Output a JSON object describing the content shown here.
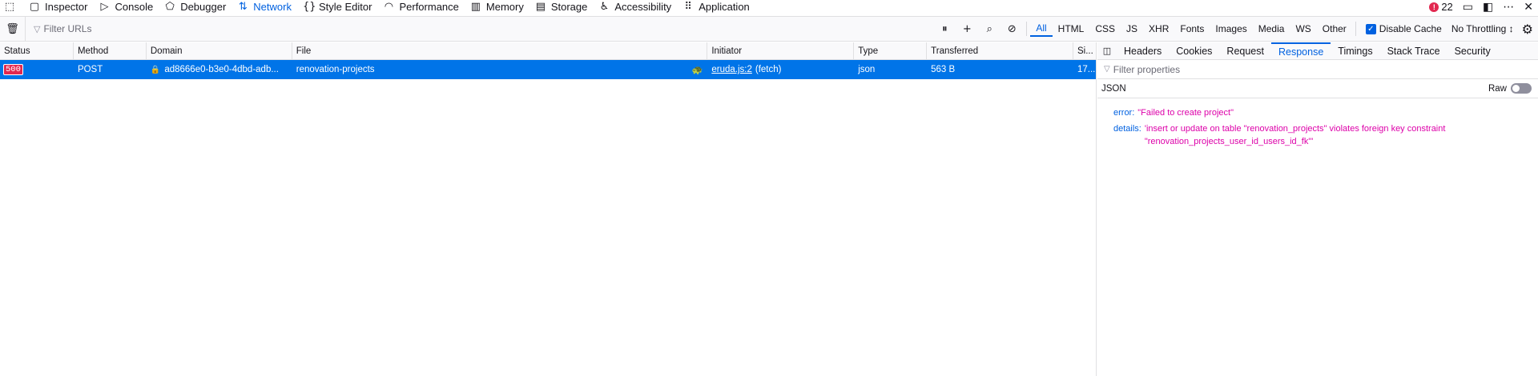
{
  "toolbar": {
    "tabs": [
      {
        "label": "Inspector",
        "icon": "inspector-icon"
      },
      {
        "label": "Console",
        "icon": "console-icon"
      },
      {
        "label": "Debugger",
        "icon": "debugger-icon"
      },
      {
        "label": "Network",
        "icon": "network-icon"
      },
      {
        "label": "Style Editor",
        "icon": "style-editor-icon"
      },
      {
        "label": "Performance",
        "icon": "performance-icon"
      },
      {
        "label": "Memory",
        "icon": "memory-icon"
      },
      {
        "label": "Storage",
        "icon": "storage-icon"
      },
      {
        "label": "Accessibility",
        "icon": "accessibility-icon"
      },
      {
        "label": "Application",
        "icon": "application-icon"
      }
    ],
    "active_tab": "Network",
    "error_count": "22"
  },
  "filterbar": {
    "placeholder": "Filter URLs",
    "types": [
      "All",
      "HTML",
      "CSS",
      "JS",
      "XHR",
      "Fonts",
      "Images",
      "Media",
      "WS",
      "Other"
    ],
    "active_type": "All",
    "disable_cache_label": "Disable Cache",
    "throttling": "No Throttling ↕"
  },
  "table": {
    "columns": [
      "Status",
      "Method",
      "Domain",
      "File",
      "Initiator",
      "Type",
      "Transferred",
      "Si..."
    ],
    "rows": [
      {
        "status": "500",
        "method": "POST",
        "domain": "ad8666e0-b3e0-4dbd-adb...",
        "file": "renovation-projects",
        "initiator_link": "eruda.js:2",
        "initiator_extra": "(fetch)",
        "type": "json",
        "transferred": "563 B",
        "size": "17..."
      }
    ]
  },
  "details": {
    "tabs": [
      "Headers",
      "Cookies",
      "Request",
      "Response",
      "Timings",
      "Stack Trace",
      "Security"
    ],
    "active_tab": "Response",
    "filter_placeholder": "Filter properties",
    "json_label": "JSON",
    "raw_label": "Raw",
    "json": [
      {
        "key": "error:",
        "value": "\"Failed to create project\""
      },
      {
        "key": "details:",
        "value": "'insert or update on table \"renovation_projects\" violates foreign key constraint \"renovation_projects_user_id_users_id_fk\"'"
      }
    ]
  }
}
